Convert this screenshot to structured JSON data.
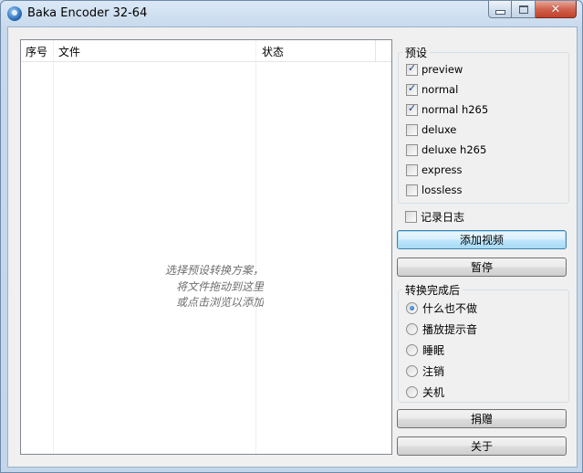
{
  "window": {
    "title": "Baka Encoder 32-64",
    "controls": {
      "minimize_icon": "minimize-icon",
      "maximize_icon": "maximize-icon",
      "close_icon": "close-icon",
      "close_glyph": "✕"
    }
  },
  "file_list": {
    "columns": [
      "序号",
      "文件",
      "状态"
    ],
    "hint_lines": [
      "选择预设转换方案，",
      "将文件拖动到这里",
      "或点击浏览以添加"
    ]
  },
  "presets": {
    "title": "预设",
    "items": [
      {
        "label": "preview",
        "checked": true
      },
      {
        "label": "normal",
        "checked": true
      },
      {
        "label": "normal h265",
        "checked": true
      },
      {
        "label": "deluxe",
        "checked": false
      },
      {
        "label": "deluxe h265",
        "checked": false
      },
      {
        "label": "express",
        "checked": false
      },
      {
        "label": "lossless",
        "checked": false
      }
    ]
  },
  "log_checkbox": {
    "label": "记录日志",
    "checked": false
  },
  "buttons": {
    "add_video": "添加视频",
    "pause": "暂停",
    "donate": "捐赠",
    "about": "关于"
  },
  "after_convert": {
    "title": "转换完成后",
    "options": [
      {
        "label": "什么也不做",
        "selected": true
      },
      {
        "label": "播放提示音",
        "selected": false
      },
      {
        "label": "睡眠",
        "selected": false
      },
      {
        "label": "注销",
        "selected": false
      },
      {
        "label": "关机",
        "selected": false
      }
    ]
  },
  "colors": {
    "accent": "#3c7fb1",
    "titlebar": "#c7d9ec",
    "close": "#c2402a"
  }
}
